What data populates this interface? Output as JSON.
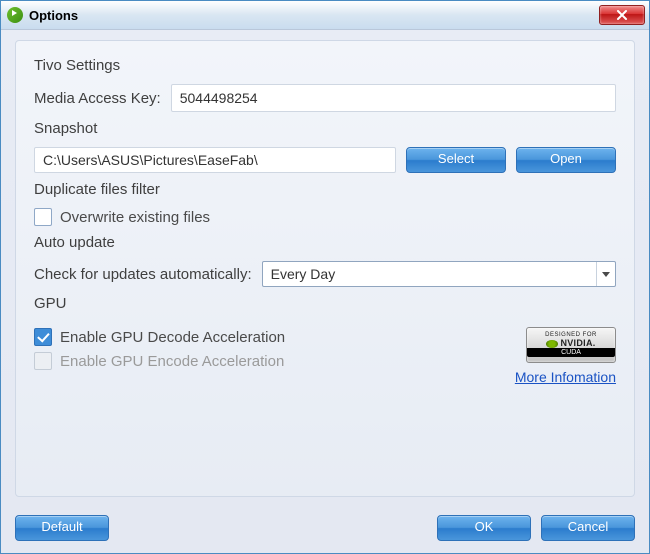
{
  "window": {
    "title": "Options"
  },
  "tivo": {
    "section": "Tivo Settings",
    "mak_label": "Media Access Key:",
    "mak_value": "5044498254"
  },
  "snapshot": {
    "section": "Snapshot",
    "path_value": "C:\\Users\\ASUS\\Pictures\\EaseFab\\",
    "select_label": "Select",
    "open_label": "Open"
  },
  "dupfilter": {
    "section": "Duplicate files filter",
    "overwrite_label": "Overwrite existing files",
    "overwrite_checked": false
  },
  "autoupdate": {
    "section": "Auto update",
    "check_label": "Check for updates automatically:",
    "selected": "Every Day"
  },
  "gpu": {
    "section": "GPU",
    "decode_label": "Enable GPU Decode Acceleration",
    "decode_checked": true,
    "encode_label": "Enable GPU Encode Acceleration",
    "encode_checked": false,
    "encode_disabled": true,
    "nvidia_top": "DESIGNED FOR",
    "nvidia_name": "NVIDIA.",
    "nvidia_bottom": "CUDA",
    "more_info": "More Infomation"
  },
  "footer": {
    "default_label": "Default",
    "ok_label": "OK",
    "cancel_label": "Cancel"
  }
}
